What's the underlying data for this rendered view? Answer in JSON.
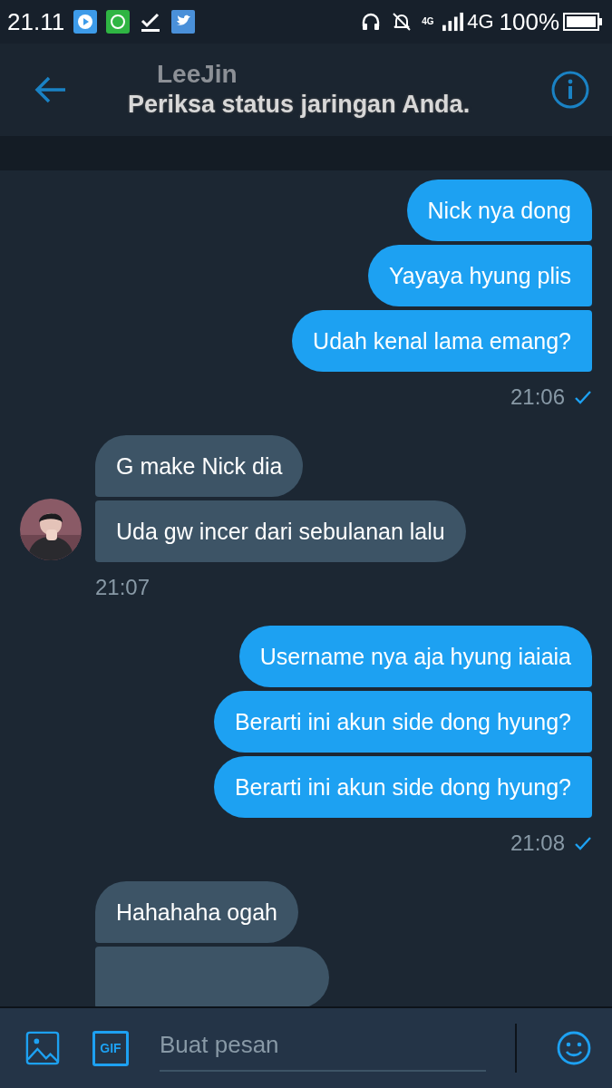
{
  "status_bar": {
    "time": "21.11",
    "network_small": "4G",
    "network": "4G",
    "battery": "100%"
  },
  "header": {
    "name": "LeeJin",
    "toast": "Periksa status jaringan Anda."
  },
  "groups": [
    {
      "kind": "sent",
      "messages": [
        "Nick nya dong",
        "Yayaya hyung plis",
        "Udah kenal lama emang?"
      ],
      "time": "21:06",
      "read": true
    },
    {
      "kind": "received",
      "messages": [
        "G make Nick dia",
        "Uda gw incer dari sebulanan lalu"
      ],
      "time": "21:07"
    },
    {
      "kind": "sent",
      "messages": [
        "Username nya aja hyung iaiaia",
        "Berarti ini akun side dong hyung?",
        "Berarti ini akun side dong hyung?"
      ],
      "time": "21:08",
      "read": true
    },
    {
      "kind": "received",
      "messages": [
        "Hahahaha ogah"
      ],
      "cut_bubble": true
    }
  ],
  "composer": {
    "placeholder": "Buat pesan",
    "gif_label": "GIF"
  }
}
